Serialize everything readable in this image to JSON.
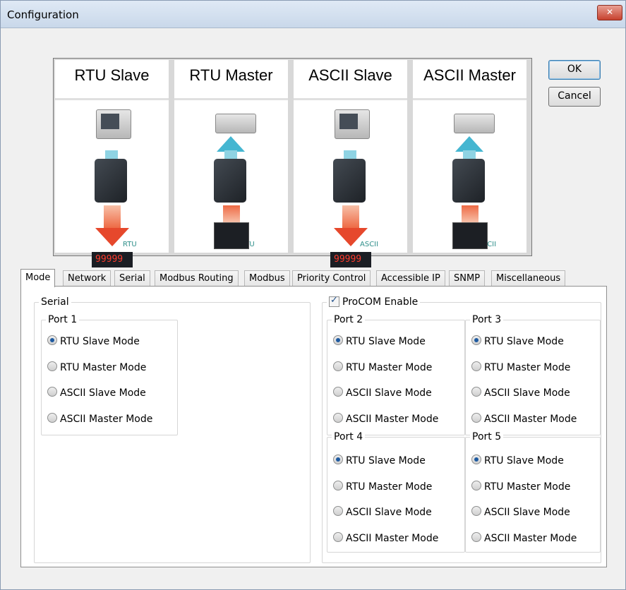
{
  "window": {
    "title": "Configuration",
    "close_label": "✕"
  },
  "banner": {
    "panels": [
      {
        "title": "RTU Slave",
        "protocol": "RTU"
      },
      {
        "title": "RTU Master",
        "protocol": "RTU"
      },
      {
        "title": "ASCII Slave",
        "protocol": "ASCII"
      },
      {
        "title": "ASCII Master",
        "protocol": "ASCII"
      }
    ],
    "meter_display": "99999"
  },
  "buttons": {
    "ok": "OK",
    "cancel": "Cancel"
  },
  "tabs": [
    "Mode",
    "Network",
    "Serial",
    "Modbus Routing",
    "Modbus",
    "Priority Control",
    "Accessible IP",
    "SNMP",
    "Miscellaneous"
  ],
  "mode": {
    "serial_label": "Serial",
    "procom_label": "ProCOM Enable",
    "procom_checked": true,
    "options": [
      "RTU Slave Mode",
      "RTU Master Mode",
      "ASCII Slave Mode",
      "ASCII Master Mode"
    ],
    "ports": [
      {
        "label": "Port 1",
        "selected": "RTU Slave Mode"
      },
      {
        "label": "Port 2",
        "selected": "RTU Slave Mode"
      },
      {
        "label": "Port 3",
        "selected": "RTU Slave Mode"
      },
      {
        "label": "Port 4",
        "selected": "RTU Slave Mode"
      },
      {
        "label": "Port 5",
        "selected": "RTU Slave Mode"
      }
    ]
  }
}
